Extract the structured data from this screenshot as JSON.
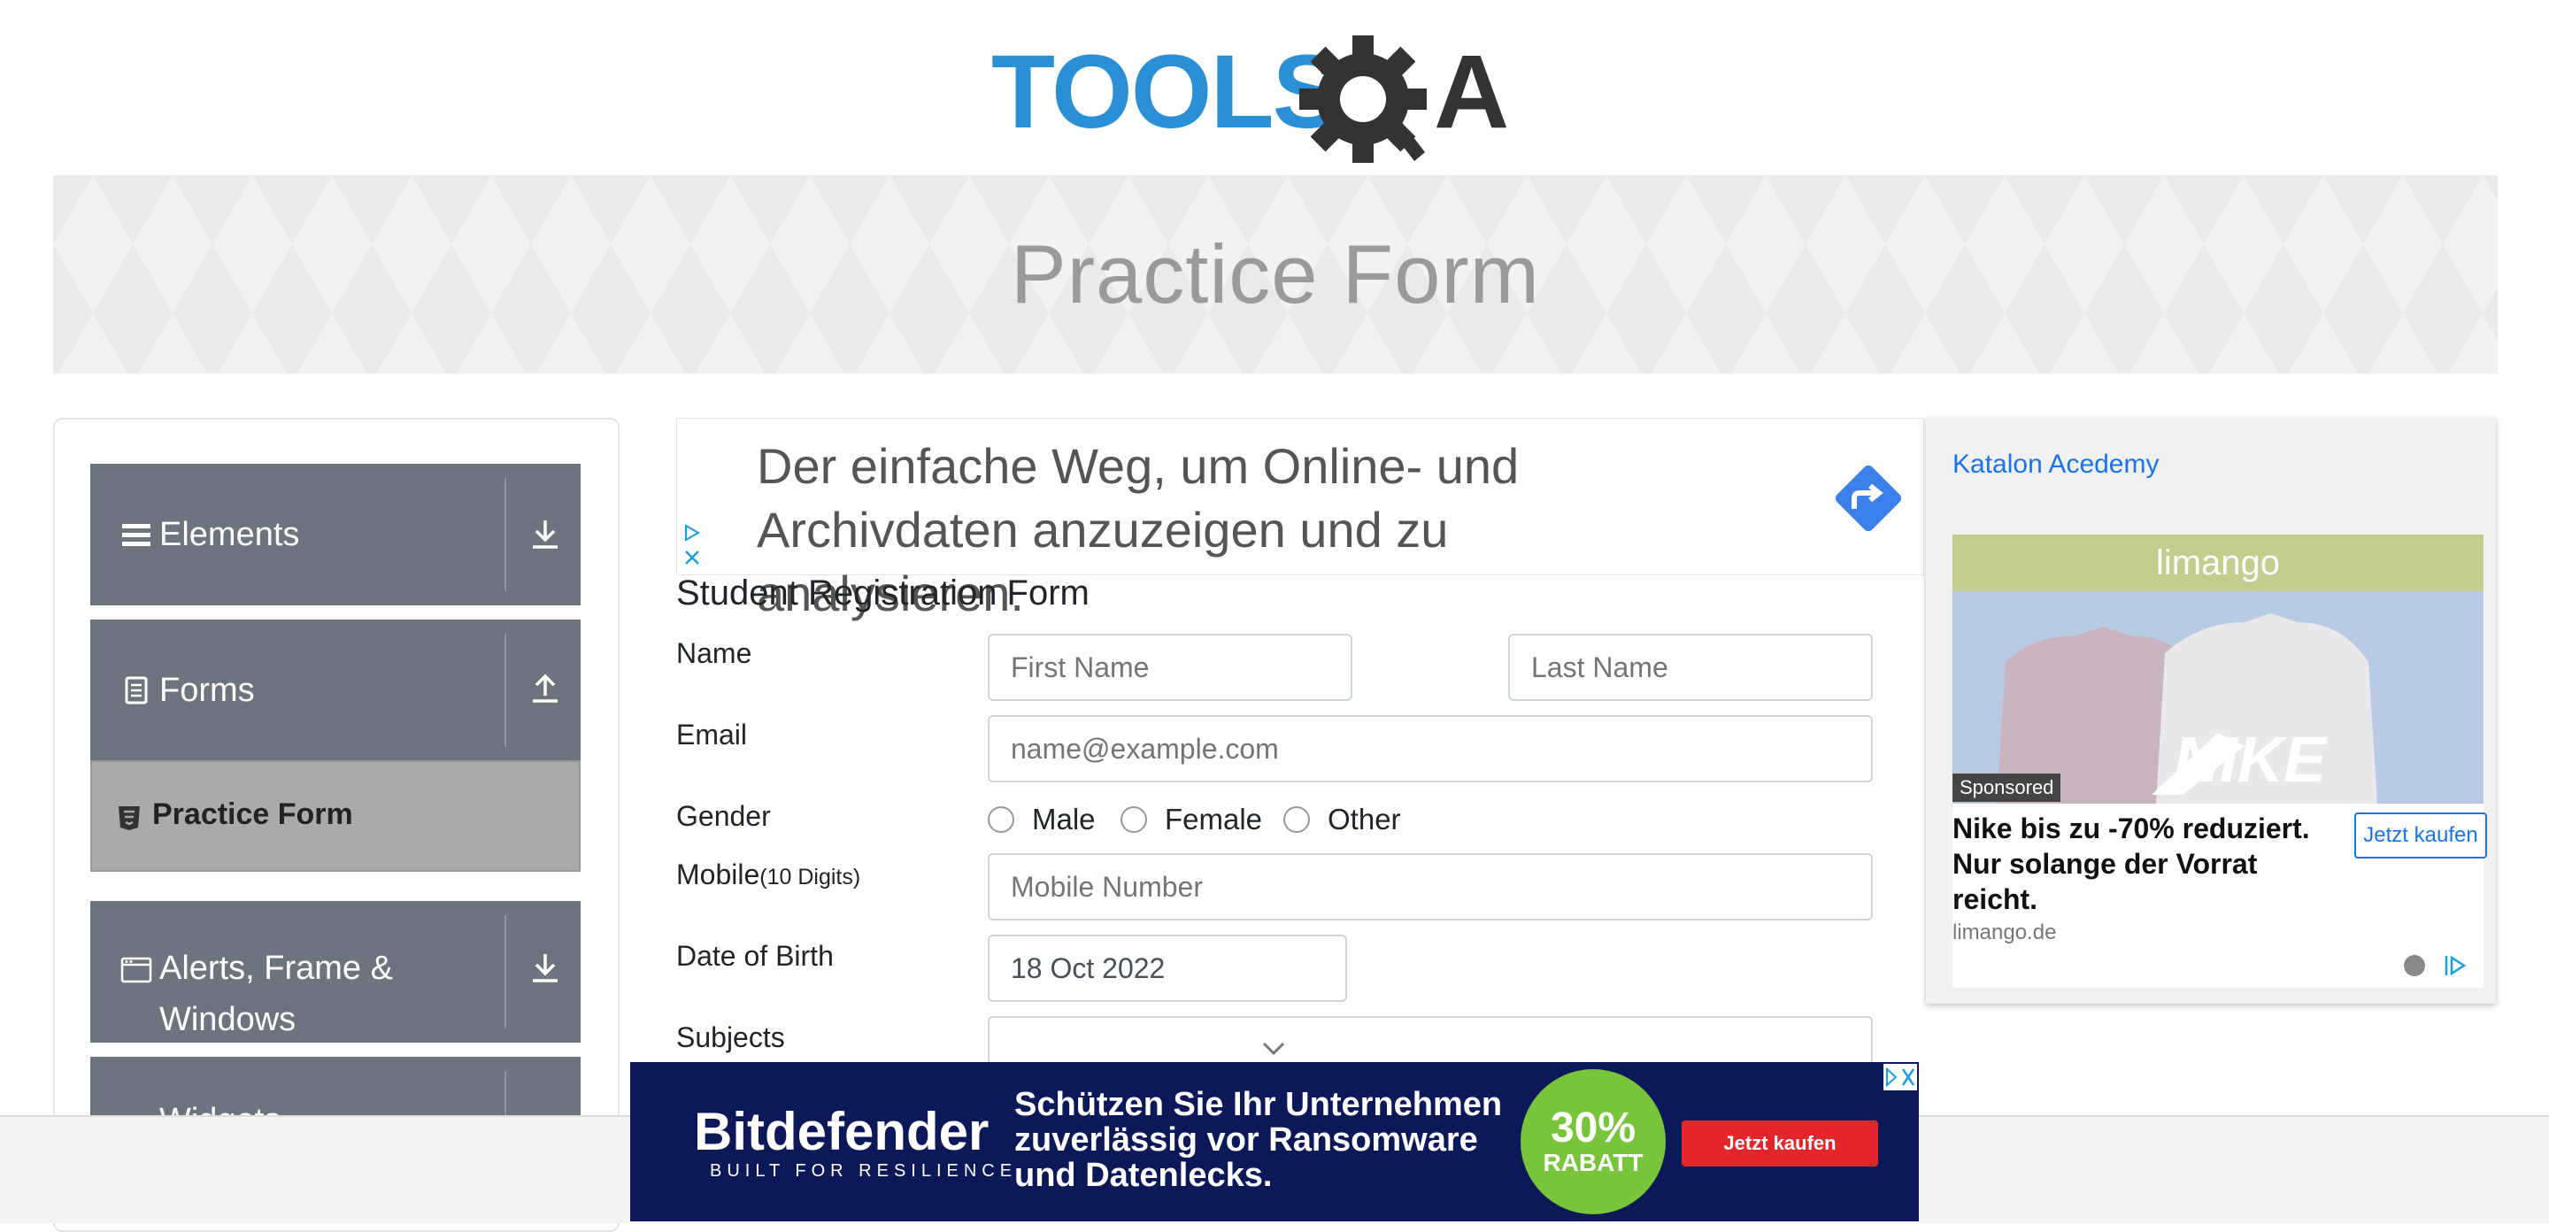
{
  "header": {
    "logo_text": "TOOLSQA"
  },
  "banner": {
    "title": "Practice Form"
  },
  "sidebar": {
    "groups": [
      {
        "label": "Elements"
      },
      {
        "label": "Forms"
      },
      {
        "label": "Alerts, Frame &"
      },
      {
        "label": "Widgets"
      }
    ],
    "alerts_line2": "Windows",
    "active_item": "Practice Form"
  },
  "ad_top": {
    "text": "Der einfache Weg, um Online- und Archivdaten anzuzeigen und zu analysieren."
  },
  "form": {
    "title": "Student Registration Form",
    "name_label": "Name",
    "first_name_placeholder": "First Name",
    "last_name_placeholder": "Last Name",
    "email_label": "Email",
    "email_placeholder": "name@example.com",
    "gender_label": "Gender",
    "gender_options": [
      "Male",
      "Female",
      "Other"
    ],
    "mobile_label": "Mobile",
    "mobile_hint": "(10 Digits)",
    "mobile_placeholder": "Mobile Number",
    "dob_label": "Date of Birth",
    "dob_value": "18 Oct 2022",
    "subjects_label": "Subjects"
  },
  "ad_right": {
    "link_text": "Katalon Acedemy",
    "brand": "limango",
    "sponsored": "Sponsored",
    "image_text": "NIKE",
    "headline": "Nike bis zu -70% reduziert. Nur solange der Vorrat reicht.",
    "cta": "Jetzt kaufen",
    "domain": "limango.de"
  },
  "ad_bottom": {
    "brand": "Bitdefender",
    "tagline": "BUILT FOR RESILIENCE",
    "text": "Schützen Sie Ihr Unternehmen zuverlässig vor Ransomware und Datenlecks.",
    "discount": "30%",
    "discount_label": "RABATT",
    "cta": "Jetzt kaufen"
  },
  "colors": {
    "sidebar_group": "#6c757d",
    "active_item": "#aaaaaa",
    "logo_blue": "#2a8fd4",
    "logo_dark": "#333333"
  }
}
